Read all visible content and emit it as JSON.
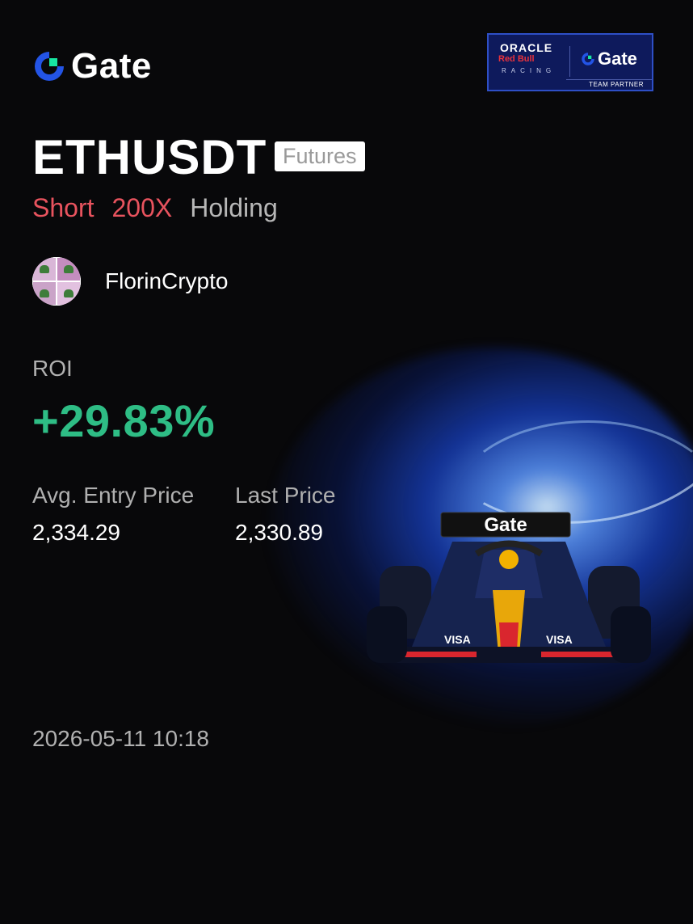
{
  "brand": {
    "name": "Gate",
    "logo_icon": "gate-logo-icon"
  },
  "partner_badge": {
    "line1": "ORACLE",
    "line2": "Red Bull",
    "line3": "RACING",
    "brand": "Gate",
    "footer": "TEAM PARTNER"
  },
  "position": {
    "symbol": "ETHUSDT",
    "market_tag": "Futures",
    "direction": "Short",
    "leverage": "200X",
    "status": "Holding"
  },
  "user": {
    "name": "FlorinCrypto",
    "avatar_icon": "frog-avatar-icon"
  },
  "roi": {
    "label": "ROI",
    "value": "+29.83%"
  },
  "prices": {
    "entry_label": "Avg. Entry Price",
    "entry_value": "2,334.29",
    "last_label": "Last Price",
    "last_value": "2,330.89"
  },
  "timestamp": "2026-05-11 10:18",
  "car": {
    "wing_text": "Gate",
    "sidepod_text": "VISA"
  },
  "colors": {
    "background": "#08080a",
    "short": "#e8535e",
    "roi": "#2ebd85",
    "muted": "#b0b0b0",
    "brand_blue": "#2354e6",
    "brand_green": "#17e6a1"
  }
}
